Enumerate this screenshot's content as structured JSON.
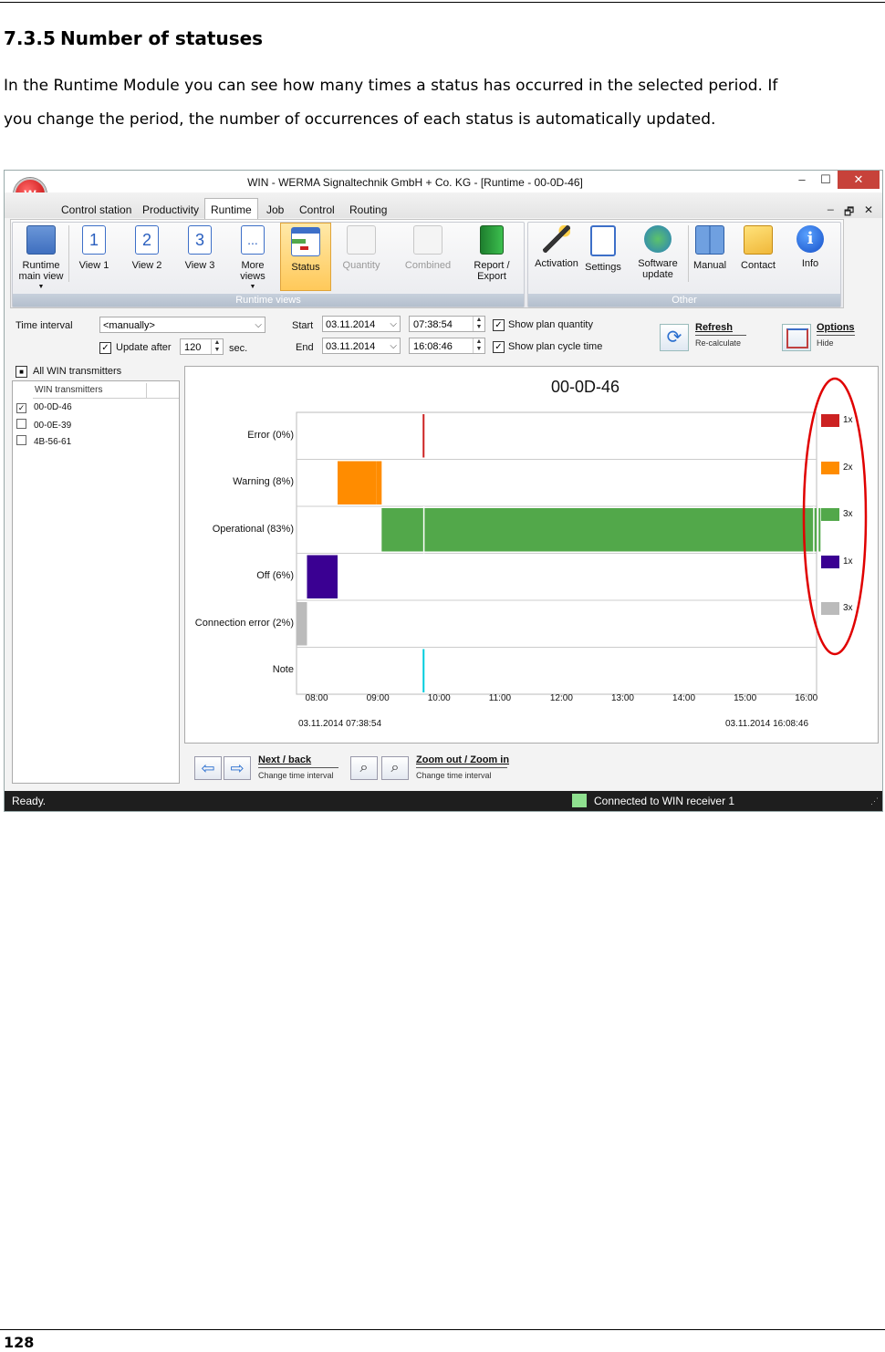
{
  "doc": {
    "section_number": "7.3.5",
    "section_title": "Number of statuses",
    "paragraph_line1": "In the Runtime Module you can see how many times a status has occurred in the selected period. If",
    "paragraph_line2": "you change the period, the number of occurrences of each status is automatically updated.",
    "page_number": "128"
  },
  "window": {
    "title": "WIN - WERMA Signaltechnik GmbH + Co. KG - [Runtime - 00-0D-46]",
    "minimize": "‒",
    "maximize": "☐",
    "close": "✕",
    "mdi_minimize": "_",
    "mdi_restore": "🗗",
    "mdi_close": "✕"
  },
  "menu": [
    {
      "label": "Control station"
    },
    {
      "label": "Productivity"
    },
    {
      "label": "Runtime"
    },
    {
      "label": "Job"
    },
    {
      "label": "Control"
    },
    {
      "label": "Routing"
    }
  ],
  "ribbon": {
    "runtime_main": "Runtime",
    "runtime_main2": "main view",
    "view1": "View 1",
    "view2": "View 2",
    "view3": "View 3",
    "more1": "More",
    "more2": "views",
    "status": "Status",
    "quantity": "Quantity",
    "combined": "Combined",
    "report1": "Report /",
    "report2": "Export",
    "group_runtime": "Runtime views",
    "activation": "Activation",
    "settings": "Settings",
    "software1": "Software",
    "software2": "update",
    "manual": "Manual",
    "contact": "Contact",
    "info": "Info",
    "group_other": "Other",
    "view1_icon": "1",
    "view2_icon": "2",
    "view3_icon": "3",
    "more_icon": "...",
    "info_icon": "i"
  },
  "controls": {
    "time_interval_label": "Time interval",
    "time_interval_value": "<manually>",
    "update_after_label": "Update after",
    "update_after_value": "120",
    "sec": "sec.",
    "start_label": "Start",
    "start_date": "03.11.2014",
    "start_time": "07:38:54",
    "end_label": "End",
    "end_date": "03.11.2014",
    "end_time": "16:08:46",
    "show_plan_quantity": "Show plan quantity",
    "show_plan_cycle": "Show plan cycle time",
    "refresh": "Refresh",
    "recalculate": "Re-calculate",
    "options": "Options",
    "hide": "Hide"
  },
  "transmitters": {
    "all_label": "All WIN transmitters",
    "column": "WIN transmitters",
    "items": [
      {
        "id": "00-0D-46",
        "checked": true
      },
      {
        "id": "00-0E-39",
        "checked": false
      },
      {
        "id": "4B-56-61",
        "checked": false
      }
    ]
  },
  "bottom": {
    "next_back": "Next / back",
    "change1": "Change time interval",
    "zoom": "Zoom out / Zoom in",
    "change2": "Change time interval"
  },
  "status": {
    "ready": "Ready.",
    "connected": "Connected to WIN receiver 1",
    "connected_color": "#8fe08f"
  },
  "chart_data": {
    "type": "timeline",
    "title": "00-0D-46",
    "x_start_label": "03.11.2014 07:38:54",
    "x_end_label": "03.11.2014 16:08:46",
    "x_ticks": [
      "08:00",
      "09:00",
      "10:00",
      "11:00",
      "12:00",
      "13:00",
      "14:00",
      "15:00",
      "16:00"
    ],
    "x_range_hours": [
      7.649,
      16.146
    ],
    "rows": [
      {
        "label": "Error (0%)",
        "color": "#cc2222",
        "count": "1x",
        "segments": [
          [
            9.71,
            9.73
          ]
        ]
      },
      {
        "label": "Warning (8%)",
        "color": "#ff8c00",
        "count": "2x",
        "segments": [
          [
            8.32,
            8.95
          ],
          [
            8.95,
            9.04
          ]
        ]
      },
      {
        "label": "Operational (83%)",
        "color": "#52a84a",
        "count": "3x",
        "segments": [
          [
            9.04,
            9.73
          ],
          [
            9.73,
            16.18
          ],
          [
            16.18,
            16.146
          ]
        ]
      },
      {
        "label": "Off (6%)",
        "color": "#3a0092",
        "count": "1x",
        "segments": [
          [
            7.82,
            8.32
          ]
        ]
      },
      {
        "label": "Connection error (2%)",
        "color": "#bbbbbb",
        "count": "3x",
        "segments": [
          [
            7.649,
            7.82
          ]
        ]
      },
      {
        "label": "Note",
        "color": "#00ccdd",
        "count": "",
        "segments": [
          [
            9.71,
            9.72
          ]
        ]
      }
    ],
    "markers_hours": [
      9.73,
      16.1
    ]
  }
}
